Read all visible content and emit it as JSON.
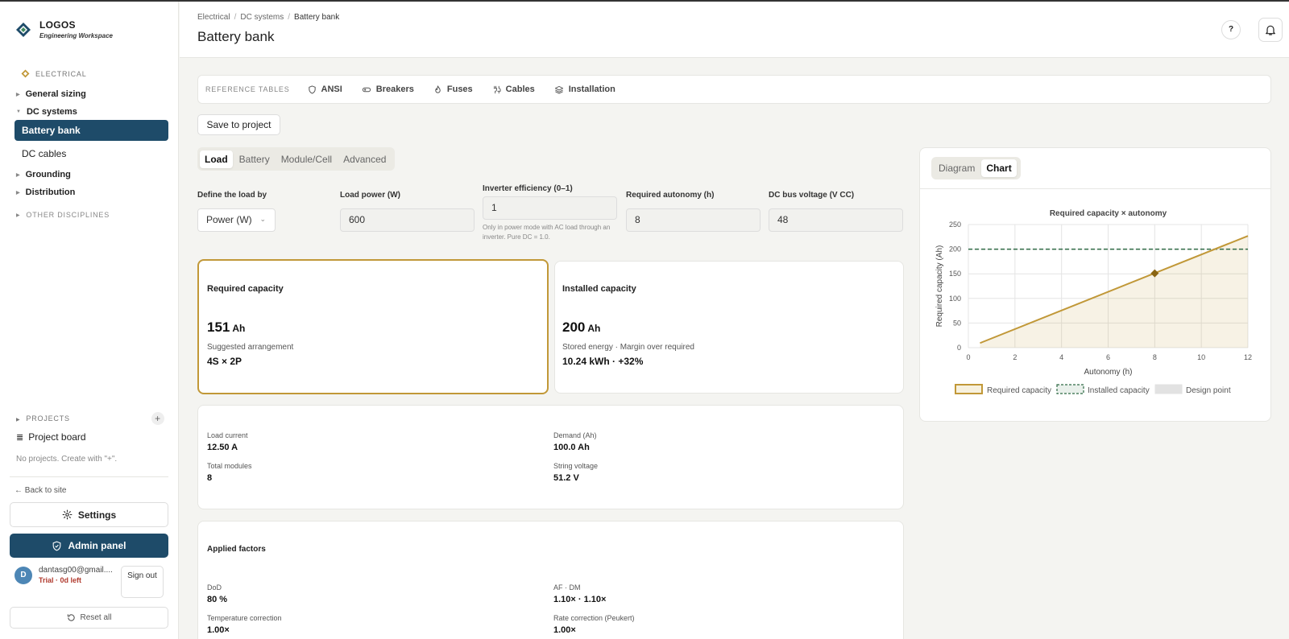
{
  "app": {
    "name": "LOGOS",
    "tagline": "Engineering Workspace"
  },
  "sidebar": {
    "section": "ELECTRICAL",
    "groups": [
      {
        "label": "General sizing"
      },
      {
        "label": "DC systems"
      },
      {
        "label": "Grounding"
      },
      {
        "label": "Distribution"
      }
    ],
    "dc_items": [
      {
        "label": "Battery bank",
        "active": true
      },
      {
        "label": "DC cables",
        "active": false
      }
    ],
    "other_disciplines": "OTHER DISCIPLINES",
    "projects_label": "PROJECTS",
    "add_symbol": "+",
    "project_board": "Project board",
    "no_projects": "No projects. Create with \"+\".",
    "back_to_site": "← Back to site",
    "settings": "Settings",
    "admin_panel": "Admin panel",
    "user": {
      "initial": "D",
      "email": "dantasg00@gmail....",
      "trial": "Trial · 0d left"
    },
    "sign_out": "Sign out",
    "reset_all": "Reset all"
  },
  "header": {
    "breadcrumbs": [
      "Electrical",
      "DC systems",
      "Battery bank"
    ],
    "title": "Battery bank",
    "help": "?"
  },
  "reference": {
    "label": "REFERENCE TABLES",
    "items": [
      "ANSI",
      "Breakers",
      "Fuses",
      "Cables",
      "Installation"
    ]
  },
  "save_button": "Save to project",
  "tabs": [
    {
      "label": "Load",
      "active": true
    },
    {
      "label": "Battery",
      "active": false
    },
    {
      "label": "Module/Cell",
      "active": false
    },
    {
      "label": "Advanced",
      "active": false
    }
  ],
  "inputs": {
    "define_by": {
      "label": "Define the load by",
      "value": "Power (W)"
    },
    "load_power": {
      "label": "Load power (W)",
      "value": "600"
    },
    "inverter_eff": {
      "label": "Inverter efficiency (0–1)",
      "value": "1",
      "hint": "Only in power mode with AC load through an inverter. Pure DC = 1.0."
    },
    "autonomy": {
      "label": "Required autonomy (h)",
      "value": "8"
    },
    "bus_voltage": {
      "label": "DC bus voltage (V CC)",
      "value": "48"
    }
  },
  "required": {
    "title": "Required capacity",
    "value": "151",
    "unit": "Ah",
    "sub_label": "Suggested arrangement",
    "sub_value": "4S × 2P"
  },
  "installed": {
    "title": "Installed capacity",
    "value": "200",
    "unit": "Ah",
    "sub_label": "Stored energy · Margin over required",
    "sub_value": "10.24 kWh · +32%"
  },
  "summary": [
    {
      "label": "Load current",
      "value": "12.50 A"
    },
    {
      "label": "Demand (Ah)",
      "value": "100.0 Ah"
    },
    {
      "label": "Total modules",
      "value": "8"
    },
    {
      "label": "String voltage",
      "value": "51.2 V"
    }
  ],
  "factors": {
    "title": "Applied factors",
    "items": [
      {
        "label": "DoD",
        "value": "80 %"
      },
      {
        "label": "AF · DM",
        "value": "1.10× · 1.10×"
      },
      {
        "label": "Temperature correction",
        "value": "1.00×"
      },
      {
        "label": "Rate correction (Peukert)",
        "value": "1.00×"
      }
    ]
  },
  "chart_tabs": [
    {
      "label": "Diagram",
      "active": false
    },
    {
      "label": "Chart",
      "active": true
    }
  ],
  "colors": {
    "primary": "#1e4b69",
    "accent": "#c19838",
    "dashed": "#2f6a45"
  },
  "chart_data": {
    "type": "line",
    "title": "Required capacity × autonomy",
    "xlabel": "Autonomy (h)",
    "ylabel": "Required capacity (Ah)",
    "xlim": [
      0,
      12
    ],
    "ylim": [
      0,
      250
    ],
    "xticks": [
      0,
      2,
      4,
      6,
      8,
      10,
      12
    ],
    "yticks": [
      0,
      50,
      100,
      150,
      200,
      250
    ],
    "grid": true,
    "legend": "bottom",
    "series": [
      {
        "name": "Required capacity",
        "x": [
          0.5,
          12
        ],
        "y": [
          9.4,
          226.9
        ]
      },
      {
        "name": "Installed capacity",
        "x": [
          0,
          12
        ],
        "y": [
          200,
          200
        ]
      },
      {
        "name": "Design point",
        "x": [
          8
        ],
        "y": [
          151
        ]
      }
    ]
  }
}
